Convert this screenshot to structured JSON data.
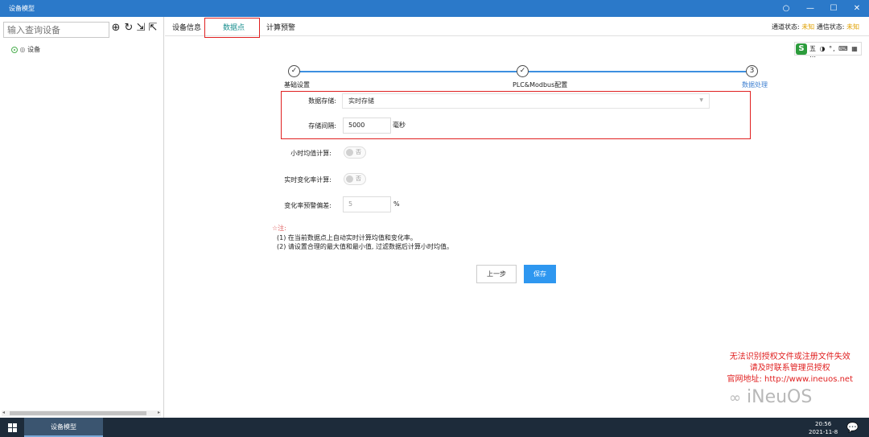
{
  "window": {
    "title": "设备模型",
    "controls": [
      "○",
      "—",
      "☐",
      "✕"
    ]
  },
  "sidebar": {
    "search_placeholder": "输入查询设备",
    "toolbar_icons": [
      "add-circle-icon",
      "refresh-icon",
      "import-icon",
      "export-icon"
    ],
    "tree_item": "设备"
  },
  "tabs": {
    "items": [
      "设备信息",
      "数据点",
      "计算预警"
    ],
    "active": "数据点"
  },
  "status": {
    "channel_label": "通道状态:",
    "channel_value": "未知",
    "comm_label": "通信状态:",
    "comm_value": "未知",
    "warn_color": "#e0a000"
  },
  "ime_toolbar": {
    "logo": "S",
    "text": "五 ◑ °, ⌨ ▦ ⋯"
  },
  "stepper": {
    "steps": [
      {
        "label": "基础设置",
        "state": "done",
        "icon": "✓"
      },
      {
        "label": "PLC&Modbus配置",
        "state": "done",
        "icon": "✓"
      },
      {
        "label": "数据处理",
        "state": "current",
        "icon": "3"
      }
    ]
  },
  "form": {
    "storage_label": "数据存储:",
    "storage_value": "实时存储",
    "interval_label": "存储间隔:",
    "interval_value": "5000",
    "interval_unit": "毫秒",
    "hourly_avg_label": "小时均值计算:",
    "hourly_avg_toggle": "否",
    "rate_label": "实时变化率计算:",
    "rate_toggle": "否",
    "deviation_label": "变化率预警偏差:",
    "deviation_value": "5",
    "deviation_unit": "%"
  },
  "notes": {
    "head": "☆注:",
    "lines": [
      "(1) 在当前数据点上自动实时计算均值和变化率。",
      "(2) 请设置合理的最大值和最小值, 过滤数据后计算小时均值。"
    ]
  },
  "buttons": {
    "prev": "上一步",
    "save": "保存"
  },
  "license": {
    "line1": "无法识别授权文件或注册文件失效",
    "line2": "请及时联系管理员授权",
    "line3": "官网地址: http://www.ineuos.net"
  },
  "watermark": "iNeuOS",
  "taskbar": {
    "app": "设备模型",
    "time": "20:56",
    "date": "2021-11-8"
  }
}
